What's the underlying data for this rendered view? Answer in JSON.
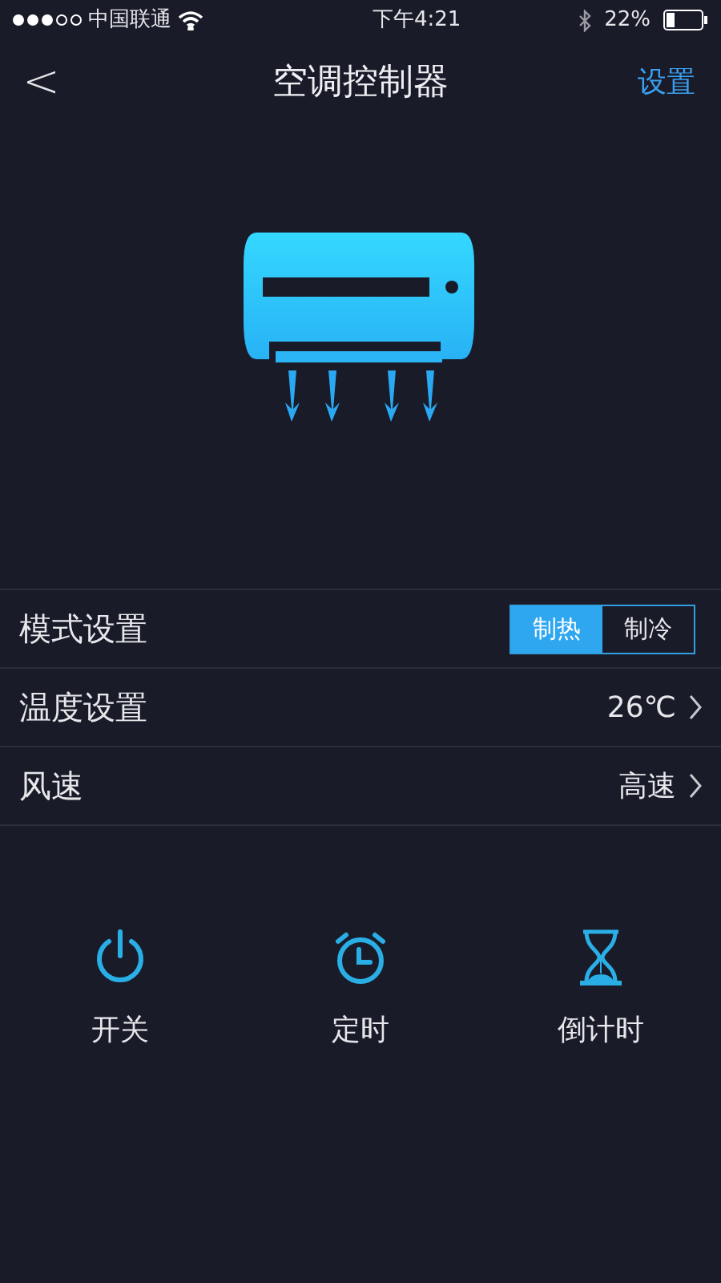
{
  "status_bar": {
    "carrier": "中国联通",
    "time": "下午4:21",
    "battery": "22%"
  },
  "nav": {
    "back": "<",
    "title": "空调控制器",
    "action": "设置"
  },
  "settings": [
    {
      "kind": "segmented",
      "label": "模式设置",
      "options": [
        {
          "label": "制热",
          "selected": true
        },
        {
          "label": "制冷",
          "selected": false
        }
      ]
    },
    {
      "kind": "value",
      "label": "温度设置",
      "value": "26℃"
    },
    {
      "kind": "value",
      "label": "风速",
      "value": "高速"
    }
  ],
  "actions": [
    {
      "kind": "power",
      "label": "开关"
    },
    {
      "kind": "alarm",
      "label": "定时"
    },
    {
      "kind": "hourglass",
      "label": "倒计时"
    }
  ]
}
